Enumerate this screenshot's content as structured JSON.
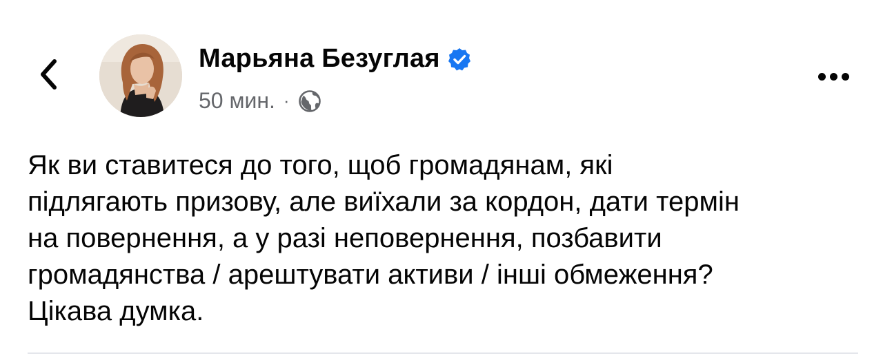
{
  "header": {
    "back_icon": "chevron-left-icon",
    "more_icon": "ellipsis-horizontal-icon"
  },
  "author": {
    "name": "Марьяна Безуглая",
    "verified": true,
    "verified_color": "#1877f2",
    "avatar_icon": "profile-photo"
  },
  "meta": {
    "time": "50 мин.",
    "separator": "·",
    "audience_icon": "globe-icon"
  },
  "post": {
    "text": "Як ви ставитеся до того, щоб громадянам, які\nпідлягають призову, але виїхали за кордон, дати термін\nна повернення, а у разі неповернення, позбавити\nгромадянства / арештувати активи / інші обмеження?\nЦікава думка."
  },
  "colors": {
    "text_primary": "#050505",
    "text_secondary": "#65676b",
    "divider": "#e4e6eb"
  }
}
